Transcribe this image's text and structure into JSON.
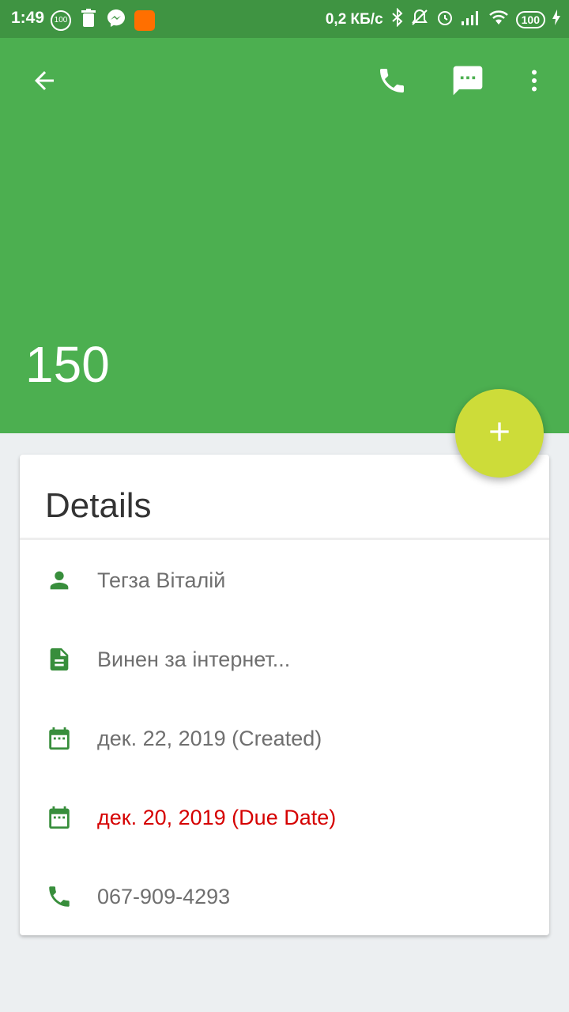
{
  "status_bar": {
    "time": "1:49",
    "notif_badge": "100",
    "net_speed": "0,2 КБ/с",
    "battery": "100"
  },
  "app_bar": {
    "amount": "150"
  },
  "colors": {
    "primary": "#4caf50",
    "status_bar": "#3f9442",
    "fab": "#cddc39",
    "icon": "#388e3c",
    "due_text": "#d50000"
  },
  "details": {
    "title": "Details",
    "person": "Тегза Віталій",
    "note": "Винен за інтернет...",
    "created": "дек. 22, 2019 (Created)",
    "due": "дек. 20, 2019 (Due Date)",
    "phone": "067-909-4293"
  },
  "icons": {
    "back": "arrow-back-icon",
    "call": "phone-icon",
    "message": "message-icon",
    "more": "more-vert-icon",
    "add": "plus-icon",
    "person": "person-icon",
    "note": "document-icon",
    "calendar": "calendar-icon",
    "phone": "phone-icon"
  }
}
